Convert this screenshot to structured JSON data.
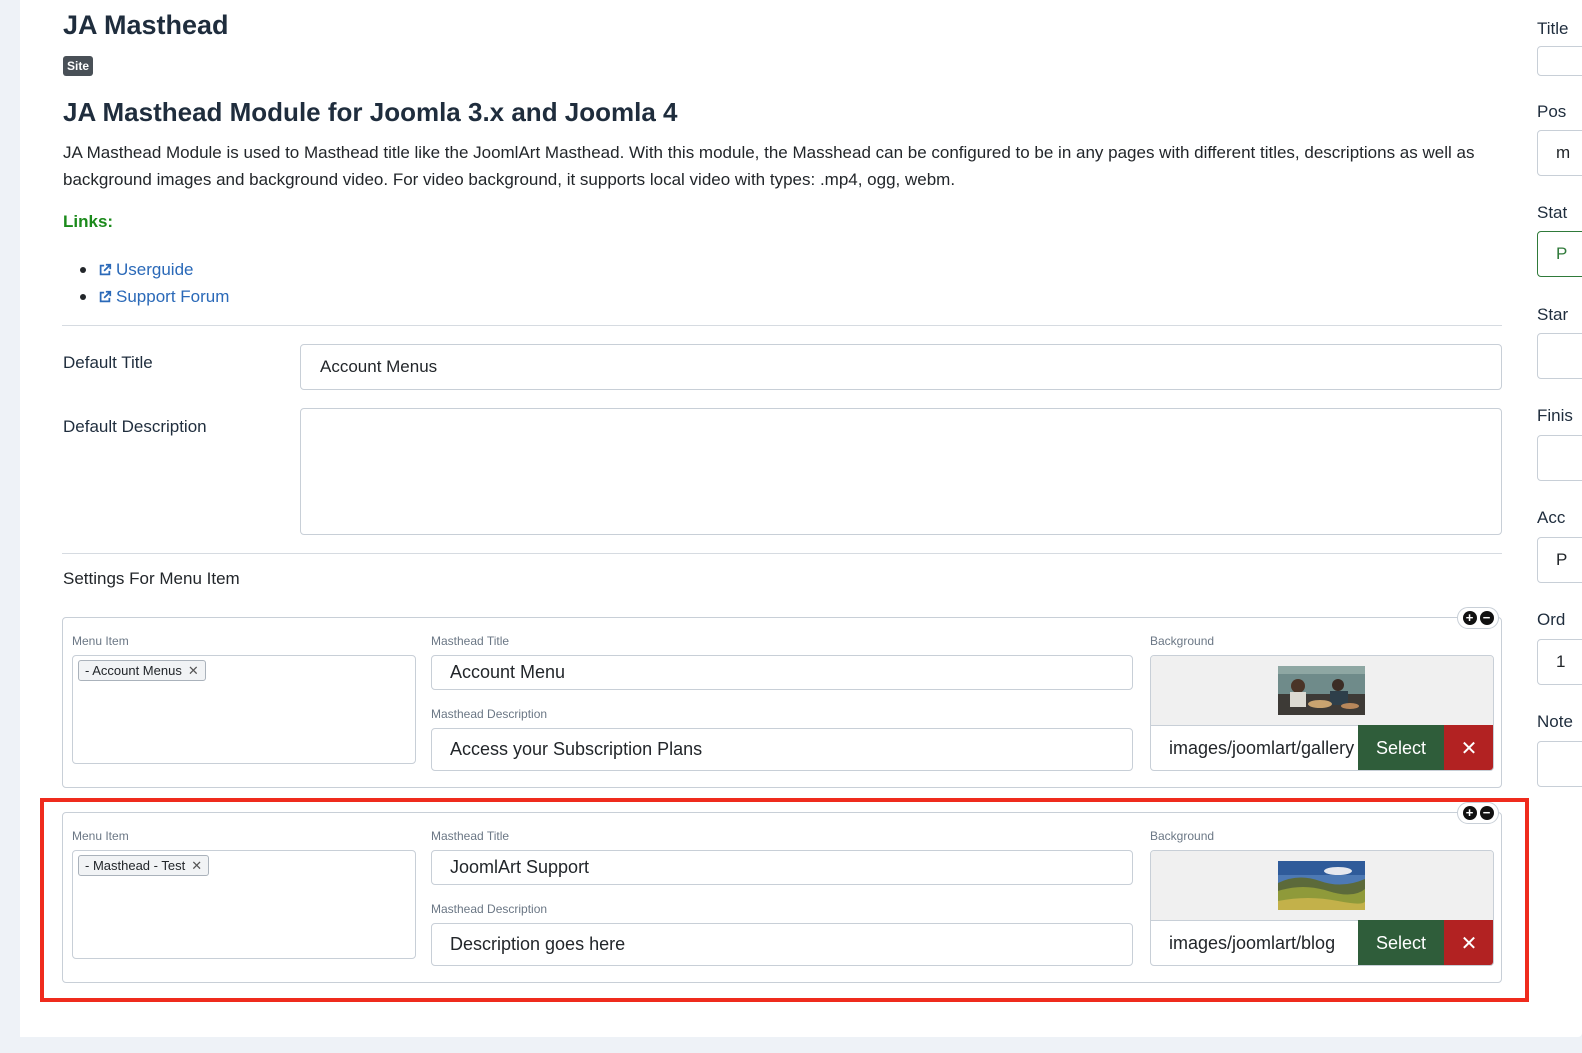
{
  "module": {
    "name": "JA Masthead",
    "client_badge": "Site",
    "heading": "JA Masthead Module for Joomla 3.x and Joomla 4",
    "description": "JA Masthead Module is used to Masthead title like the JoomlArt Masthead. With this module, the Masshead can be configured to be in any pages with different titles, descriptions as well as background images and background video. For video background, it supports local video with types: .mp4, ogg, webm.",
    "links_label": "Links:",
    "links": [
      "Userguide",
      "Support Forum"
    ]
  },
  "form": {
    "default_title_label": "Default Title",
    "default_title_value": "Account Menus",
    "default_description_label": "Default Description",
    "default_description_value": "",
    "settings_title": "Settings For Menu Item"
  },
  "labels": {
    "menu_item": "Menu Item",
    "masthead_title": "Masthead Title",
    "masthead_description": "Masthead Description",
    "background": "Background",
    "select": "Select",
    "remove": "✕",
    "chip_remove": "✕",
    "add": "+",
    "minus": "−"
  },
  "rows": [
    {
      "menu_item": "- Account Menus",
      "title": "Account Menu",
      "description": "Access your Subscription Plans",
      "background_path": "images/joomlart/gallery"
    },
    {
      "menu_item": "- Masthead - Test",
      "title": "JoomlArt Support",
      "description": "Description goes here",
      "background_path": "images/joomlart/blog"
    }
  ],
  "sidebar": {
    "labels": [
      "Title",
      "Pos",
      "Stat",
      "Star",
      "Finis",
      "Acc",
      "Ord",
      "Note"
    ],
    "values": [
      "",
      "m",
      "P",
      "",
      "",
      "P",
      "1",
      ""
    ]
  },
  "colors": {
    "links_label": "#1b8a1b",
    "link": "#2a69b8",
    "select_button": "#2f5d3a",
    "remove_button": "#b22222",
    "highlight_frame": "#ef2b1d"
  }
}
